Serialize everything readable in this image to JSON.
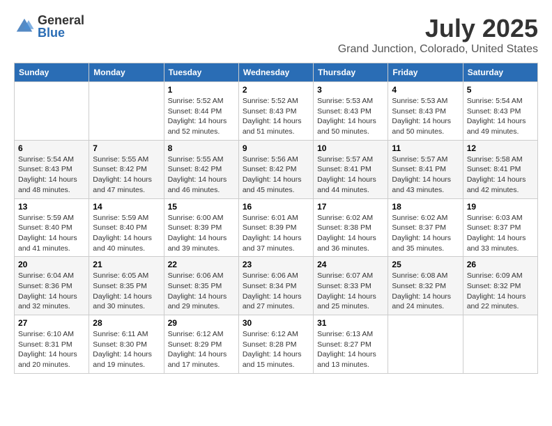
{
  "logo": {
    "general": "General",
    "blue": "Blue"
  },
  "title": "July 2025",
  "location": "Grand Junction, Colorado, United States",
  "days_of_week": [
    "Sunday",
    "Monday",
    "Tuesday",
    "Wednesday",
    "Thursday",
    "Friday",
    "Saturday"
  ],
  "weeks": [
    [
      {
        "day": "",
        "sunrise": "",
        "sunset": "",
        "daylight": ""
      },
      {
        "day": "",
        "sunrise": "",
        "sunset": "",
        "daylight": ""
      },
      {
        "day": "1",
        "sunrise": "Sunrise: 5:52 AM",
        "sunset": "Sunset: 8:44 PM",
        "daylight": "Daylight: 14 hours and 52 minutes."
      },
      {
        "day": "2",
        "sunrise": "Sunrise: 5:52 AM",
        "sunset": "Sunset: 8:43 PM",
        "daylight": "Daylight: 14 hours and 51 minutes."
      },
      {
        "day": "3",
        "sunrise": "Sunrise: 5:53 AM",
        "sunset": "Sunset: 8:43 PM",
        "daylight": "Daylight: 14 hours and 50 minutes."
      },
      {
        "day": "4",
        "sunrise": "Sunrise: 5:53 AM",
        "sunset": "Sunset: 8:43 PM",
        "daylight": "Daylight: 14 hours and 50 minutes."
      },
      {
        "day": "5",
        "sunrise": "Sunrise: 5:54 AM",
        "sunset": "Sunset: 8:43 PM",
        "daylight": "Daylight: 14 hours and 49 minutes."
      }
    ],
    [
      {
        "day": "6",
        "sunrise": "Sunrise: 5:54 AM",
        "sunset": "Sunset: 8:43 PM",
        "daylight": "Daylight: 14 hours and 48 minutes."
      },
      {
        "day": "7",
        "sunrise": "Sunrise: 5:55 AM",
        "sunset": "Sunset: 8:42 PM",
        "daylight": "Daylight: 14 hours and 47 minutes."
      },
      {
        "day": "8",
        "sunrise": "Sunrise: 5:55 AM",
        "sunset": "Sunset: 8:42 PM",
        "daylight": "Daylight: 14 hours and 46 minutes."
      },
      {
        "day": "9",
        "sunrise": "Sunrise: 5:56 AM",
        "sunset": "Sunset: 8:42 PM",
        "daylight": "Daylight: 14 hours and 45 minutes."
      },
      {
        "day": "10",
        "sunrise": "Sunrise: 5:57 AM",
        "sunset": "Sunset: 8:41 PM",
        "daylight": "Daylight: 14 hours and 44 minutes."
      },
      {
        "day": "11",
        "sunrise": "Sunrise: 5:57 AM",
        "sunset": "Sunset: 8:41 PM",
        "daylight": "Daylight: 14 hours and 43 minutes."
      },
      {
        "day": "12",
        "sunrise": "Sunrise: 5:58 AM",
        "sunset": "Sunset: 8:41 PM",
        "daylight": "Daylight: 14 hours and 42 minutes."
      }
    ],
    [
      {
        "day": "13",
        "sunrise": "Sunrise: 5:59 AM",
        "sunset": "Sunset: 8:40 PM",
        "daylight": "Daylight: 14 hours and 41 minutes."
      },
      {
        "day": "14",
        "sunrise": "Sunrise: 5:59 AM",
        "sunset": "Sunset: 8:40 PM",
        "daylight": "Daylight: 14 hours and 40 minutes."
      },
      {
        "day": "15",
        "sunrise": "Sunrise: 6:00 AM",
        "sunset": "Sunset: 8:39 PM",
        "daylight": "Daylight: 14 hours and 39 minutes."
      },
      {
        "day": "16",
        "sunrise": "Sunrise: 6:01 AM",
        "sunset": "Sunset: 8:39 PM",
        "daylight": "Daylight: 14 hours and 37 minutes."
      },
      {
        "day": "17",
        "sunrise": "Sunrise: 6:02 AM",
        "sunset": "Sunset: 8:38 PM",
        "daylight": "Daylight: 14 hours and 36 minutes."
      },
      {
        "day": "18",
        "sunrise": "Sunrise: 6:02 AM",
        "sunset": "Sunset: 8:37 PM",
        "daylight": "Daylight: 14 hours and 35 minutes."
      },
      {
        "day": "19",
        "sunrise": "Sunrise: 6:03 AM",
        "sunset": "Sunset: 8:37 PM",
        "daylight": "Daylight: 14 hours and 33 minutes."
      }
    ],
    [
      {
        "day": "20",
        "sunrise": "Sunrise: 6:04 AM",
        "sunset": "Sunset: 8:36 PM",
        "daylight": "Daylight: 14 hours and 32 minutes."
      },
      {
        "day": "21",
        "sunrise": "Sunrise: 6:05 AM",
        "sunset": "Sunset: 8:35 PM",
        "daylight": "Daylight: 14 hours and 30 minutes."
      },
      {
        "day": "22",
        "sunrise": "Sunrise: 6:06 AM",
        "sunset": "Sunset: 8:35 PM",
        "daylight": "Daylight: 14 hours and 29 minutes."
      },
      {
        "day": "23",
        "sunrise": "Sunrise: 6:06 AM",
        "sunset": "Sunset: 8:34 PM",
        "daylight": "Daylight: 14 hours and 27 minutes."
      },
      {
        "day": "24",
        "sunrise": "Sunrise: 6:07 AM",
        "sunset": "Sunset: 8:33 PM",
        "daylight": "Daylight: 14 hours and 25 minutes."
      },
      {
        "day": "25",
        "sunrise": "Sunrise: 6:08 AM",
        "sunset": "Sunset: 8:32 PM",
        "daylight": "Daylight: 14 hours and 24 minutes."
      },
      {
        "day": "26",
        "sunrise": "Sunrise: 6:09 AM",
        "sunset": "Sunset: 8:32 PM",
        "daylight": "Daylight: 14 hours and 22 minutes."
      }
    ],
    [
      {
        "day": "27",
        "sunrise": "Sunrise: 6:10 AM",
        "sunset": "Sunset: 8:31 PM",
        "daylight": "Daylight: 14 hours and 20 minutes."
      },
      {
        "day": "28",
        "sunrise": "Sunrise: 6:11 AM",
        "sunset": "Sunset: 8:30 PM",
        "daylight": "Daylight: 14 hours and 19 minutes."
      },
      {
        "day": "29",
        "sunrise": "Sunrise: 6:12 AM",
        "sunset": "Sunset: 8:29 PM",
        "daylight": "Daylight: 14 hours and 17 minutes."
      },
      {
        "day": "30",
        "sunrise": "Sunrise: 6:12 AM",
        "sunset": "Sunset: 8:28 PM",
        "daylight": "Daylight: 14 hours and 15 minutes."
      },
      {
        "day": "31",
        "sunrise": "Sunrise: 6:13 AM",
        "sunset": "Sunset: 8:27 PM",
        "daylight": "Daylight: 14 hours and 13 minutes."
      },
      {
        "day": "",
        "sunrise": "",
        "sunset": "",
        "daylight": ""
      },
      {
        "day": "",
        "sunrise": "",
        "sunset": "",
        "daylight": ""
      }
    ]
  ]
}
